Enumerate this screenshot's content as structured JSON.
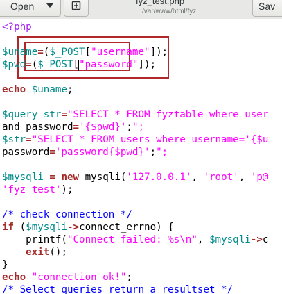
{
  "header": {
    "open_label": "Open",
    "save_label": "Sav",
    "title": "fyz_test.php",
    "subtitle": "/var/www/html/fyz"
  },
  "icons": {
    "open_chevron": "chevron-down-icon",
    "new_tab": "new-document-icon"
  },
  "code_lines": [
    "<?php",
    "",
    "$uname=($_POST[\"username\"]);",
    "$pwd=($_POST[\"password\"]);",
    "",
    "echo $uname;",
    "",
    "$query_str=\"SELECT * FROM fyztable where user",
    "and password='{$pwd}';\";",
    "$str=\"SELECT * FROM users where username='{$u",
    "password='password{$pwd}';\";",
    "",
    "$mysqli = new mysqli('127.0.0.1', 'root', 'p@",
    "'fyz_test');",
    "",
    "/* check connection */",
    "if ($mysqli->connect_errno) {",
    "    printf(\"Connect failed: %s\\n\", $mysqli->c",
    "    exit();",
    "}",
    "echo \"connection ok!\";",
    "/* Select queries return a resultset */"
  ],
  "colors": {
    "php_tag": "#a020f0",
    "variable": "#008b8b",
    "string": "#ff00ff",
    "keyword": "#a52a2a",
    "comment": "#0000ff",
    "annotation_box": "#b0282a"
  }
}
